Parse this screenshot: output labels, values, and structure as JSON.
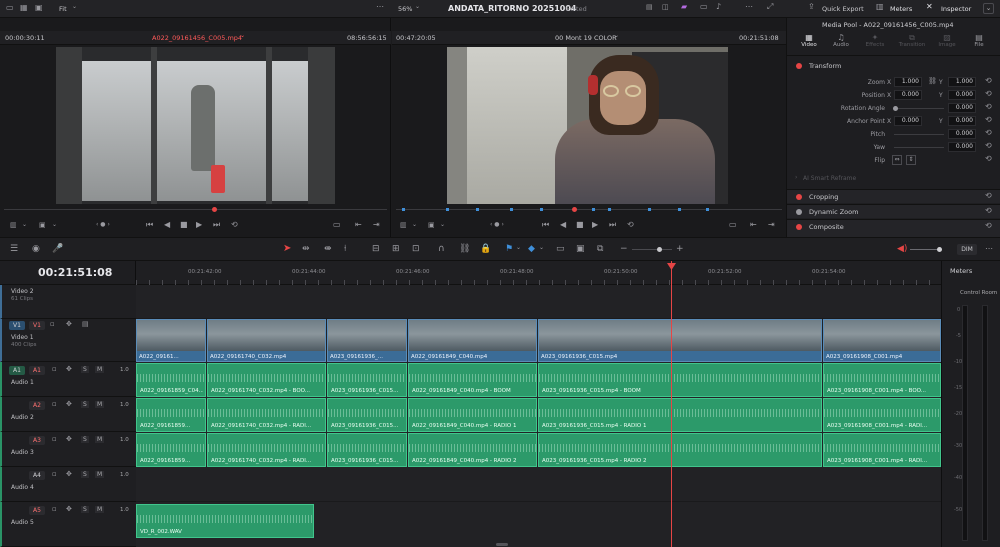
{
  "titlebar": {
    "project_title": "ANDATA_RITORNO 20251004",
    "status": "Edited",
    "quick_export": "Quick Export",
    "meters": "Meters",
    "inspector": "Inspector"
  },
  "source_viewer": {
    "zoom": "Fit",
    "timecode_left": "00:00:30:11",
    "clip_name": "A022_09161456_C005.mp4",
    "timecode_right": "08:56:56:15"
  },
  "timeline_viewer": {
    "zoom": "56%",
    "timecode_left": "00:47:20:05",
    "timeline_name": "00 Mont 19 COLOR",
    "timecode_right": "00:21:51:08"
  },
  "inspector": {
    "header_title": "Media Pool - A022_09161456_C005.mp4",
    "tabs": [
      "Video",
      "Audio",
      "Effects",
      "Transition",
      "Image",
      "File"
    ],
    "section_transform": "Transform",
    "zoom_label": "Zoom",
    "zoom_x": "1.000",
    "zoom_y": "1.000",
    "position_label": "Position",
    "position_x": "0.000",
    "position_y": "0.000",
    "rotation_label": "Rotation Angle",
    "rotation_val": "0.000",
    "anchor_label": "Anchor Point",
    "anchor_x": "0.000",
    "anchor_y": "0.000",
    "pitch_label": "Pitch",
    "pitch_val": "0.000",
    "yaw_label": "Yaw",
    "yaw_val": "0.000",
    "flip_label": "Flip",
    "x_label": "X",
    "y_label": "Y",
    "smart_reframe": "AI Smart Reframe",
    "section_cropping": "Cropping",
    "section_dynamic_zoom": "Dynamic Zoom",
    "section_composite": "Composite"
  },
  "timeline": {
    "current_timecode": "00:21:51:08",
    "ruler": [
      "00:21:42:00",
      "00:21:44:00",
      "00:21:46:00",
      "00:21:48:00",
      "00:21:50:00",
      "00:21:52:00",
      "00:21:54:00"
    ],
    "dim_label": "DIM",
    "tracks": {
      "video2": {
        "name": "Video 2",
        "sub": "61 Clips"
      },
      "video1": {
        "name": "Video 1",
        "sub": "400 Clips",
        "badge_a": "V1",
        "badge_b": "V1"
      },
      "audio1": {
        "name": "Audio 1",
        "badge_a": "A1",
        "badge_b": "A1",
        "vol": "1.0"
      },
      "audio2": {
        "name": "Audio 2",
        "badge": "A2",
        "vol": "1.0"
      },
      "audio3": {
        "name": "Audio 3",
        "badge": "A3",
        "vol": "1.0"
      },
      "audio4": {
        "name": "Audio 4",
        "badge": "A4",
        "vol": "1.0"
      },
      "audio5": {
        "name": "Audio 5",
        "badge": "A5",
        "vol": "1.0"
      }
    },
    "video_clips": [
      "A022_09161...",
      "A022_09161740_C032.mp4",
      "A023_09161936_...",
      "A022_09161849_C040.mp4",
      "A023_09161936_C015.mp4",
      "A023_09161908_C001.mp4"
    ],
    "audio1_clips": [
      "A022_09161859_C04...",
      "A022_09161740_C032.mp4 - BOO...",
      "A023_09161936_C015...",
      "A022_09161849_C040.mp4 - BOOM",
      "A023_09161936_C015.mp4 - BOOM",
      "A023_09161908_C001.mp4 - BOO..."
    ],
    "audio2_clips": [
      "A022_09161859...",
      "A022_09161740_C032.mp4 - RADI...",
      "A023_09161936_C015...",
      "A022_09161849_C040.mp4 - RADIO 1",
      "A023_09161936_C015.mp4 - RADIO 1",
      "A023_09161908_C001.mp4 - RADI..."
    ],
    "audio3_clips": [
      "A022_09161859...",
      "A022_09161740_C032.mp4 - RADI...",
      "A023_09161936_C015...",
      "A022_09161849_C040.mp4 - RADIO 2",
      "A023_09161936_C015.mp4 - RADIO 2",
      "A023_09161908_C001.mp4 - RADI..."
    ],
    "audio5_clip": "VD_R_002.WAV"
  },
  "meters_panel": {
    "title": "Meters",
    "control_room": "Control Room",
    "ticks": [
      "0",
      "-5",
      "-10",
      "-15",
      "-20",
      "-30",
      "-40",
      "-50"
    ]
  },
  "colors": {
    "accent_red": "#e64545",
    "video_clip": "#3b6c97",
    "audio_clip": "#2c9a6a",
    "playhead": "#e64545"
  }
}
